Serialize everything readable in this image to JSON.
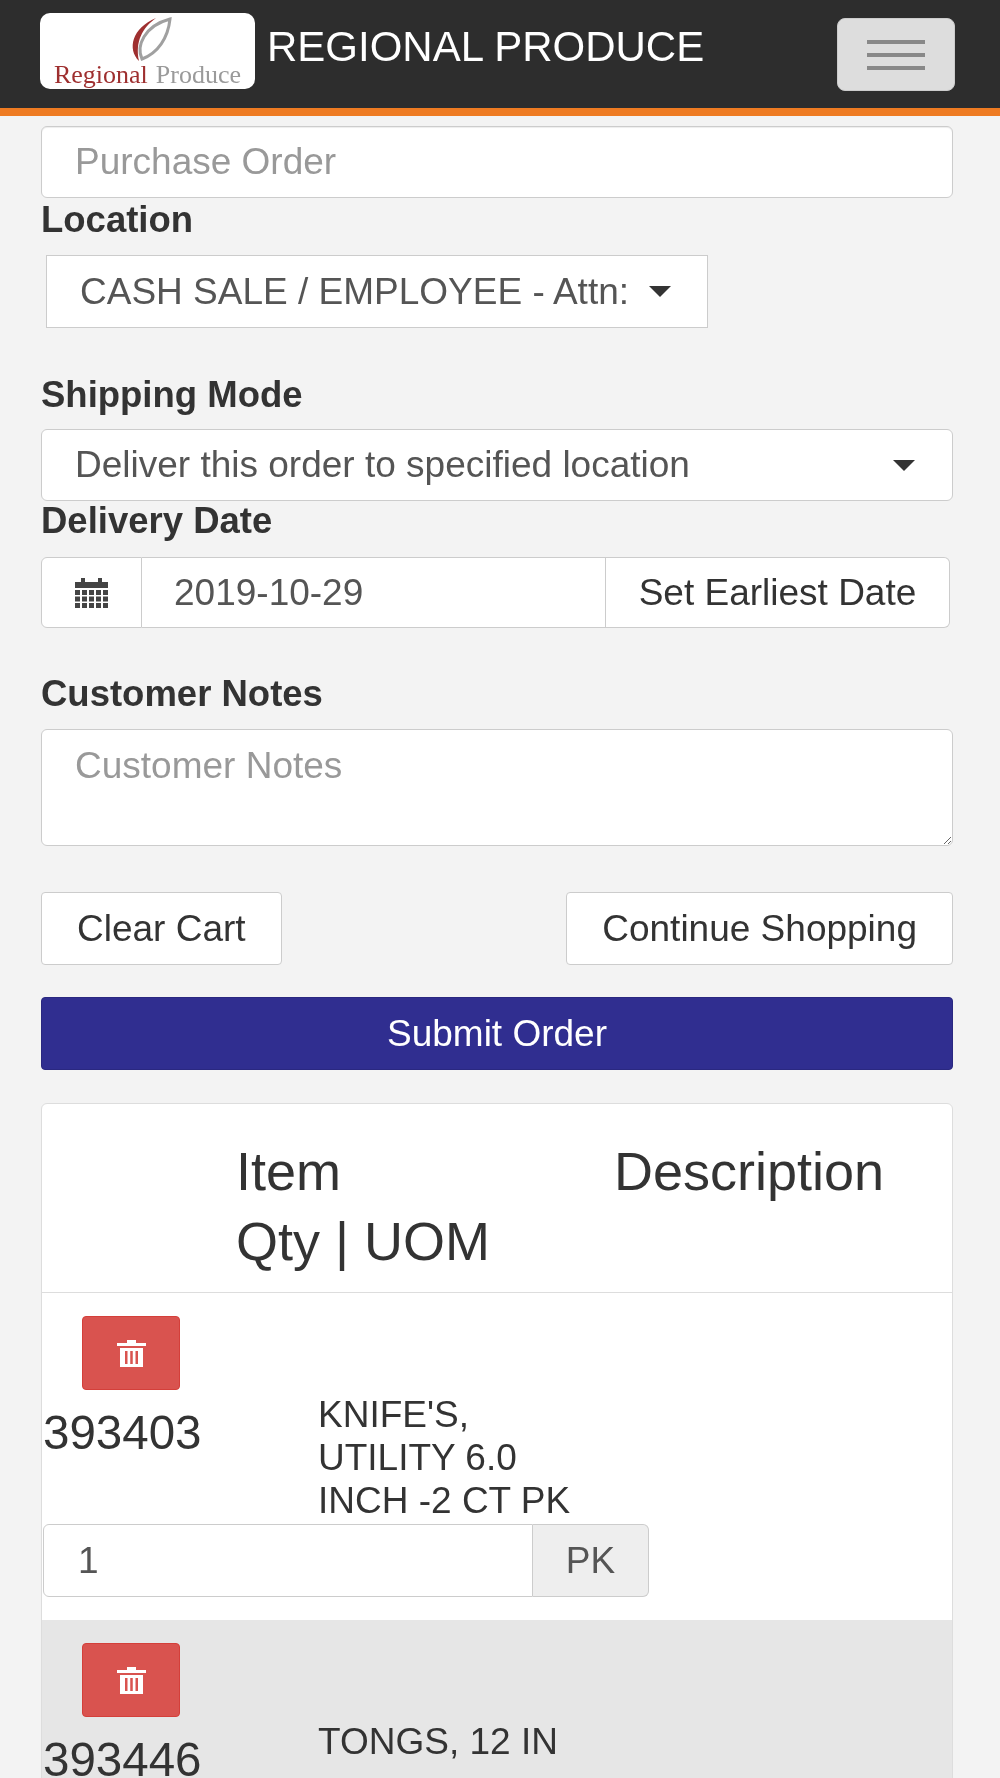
{
  "header": {
    "logo": {
      "primary": "Regional",
      "secondary": "Produce"
    },
    "title": "REGIONAL PRODUCE"
  },
  "form": {
    "purchase_order": {
      "placeholder": "Purchase Order"
    },
    "location": {
      "label": "Location",
      "value": "CASH SALE / EMPLOYEE - Attn:"
    },
    "shipping_mode": {
      "label": "Shipping Mode",
      "value": "Deliver this order to specified location"
    },
    "delivery_date": {
      "label": "Delivery Date",
      "value": "2019-10-29",
      "button": "Set Earliest Date"
    },
    "customer_notes": {
      "label": "Customer Notes",
      "placeholder": "Customer Notes"
    }
  },
  "actions": {
    "clear": "Clear Cart",
    "continue": "Continue Shopping",
    "submit": "Submit Order"
  },
  "cart": {
    "columns": [
      "Item",
      "Description",
      "Qty | UOM"
    ],
    "rows": [
      {
        "item": "393403",
        "description": "KNIFE'S, UTILITY 6.0 INCH -2 CT PK",
        "qty": "1",
        "uom": "PK"
      },
      {
        "item": "393446",
        "description": "TONGS, 12 IN"
      }
    ]
  }
}
